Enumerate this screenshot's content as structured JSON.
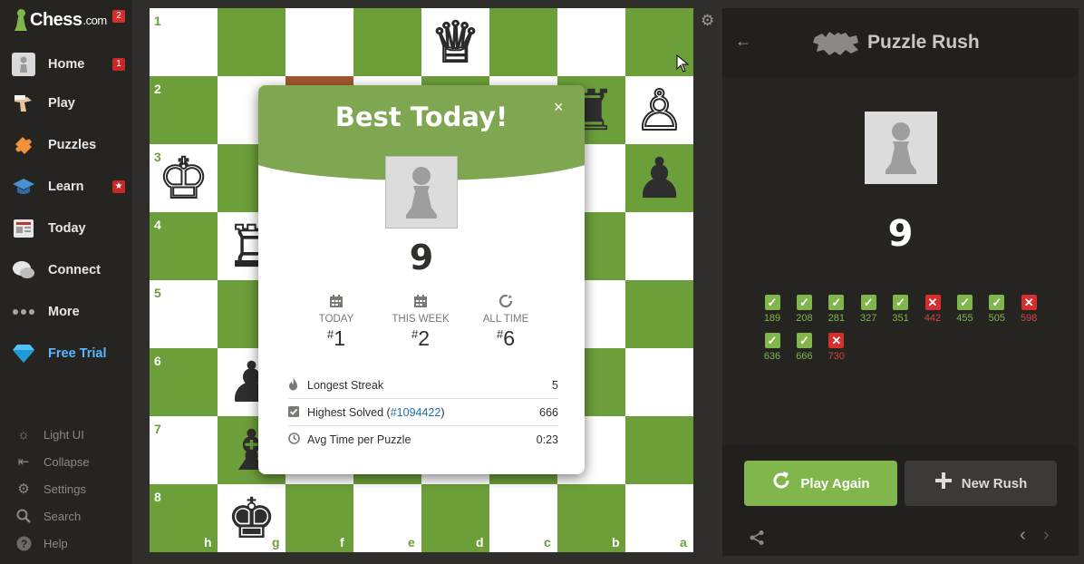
{
  "sidebar": {
    "logo": {
      "text": "Chess",
      "suffix": ".com",
      "badge": "2"
    },
    "items": [
      {
        "label": "Home",
        "icon": "home-avatar-icon",
        "badge": "1"
      },
      {
        "label": "Play",
        "icon": "play-hand-icon"
      },
      {
        "label": "Puzzles",
        "icon": "puzzle-piece-icon"
      },
      {
        "label": "Learn",
        "icon": "graduation-cap-icon",
        "badge": "★"
      },
      {
        "label": "Today",
        "icon": "newspaper-icon"
      },
      {
        "label": "Connect",
        "icon": "chat-bubbles-icon"
      },
      {
        "label": "More",
        "icon": "more-dots-icon"
      },
      {
        "label": "Free Trial",
        "icon": "diamond-icon"
      }
    ],
    "utilities": [
      {
        "label": "Light UI",
        "icon": "sun-icon"
      },
      {
        "label": "Collapse",
        "icon": "collapse-icon"
      },
      {
        "label": "Settings",
        "icon": "gear-icon"
      },
      {
        "label": "Search",
        "icon": "search-icon"
      },
      {
        "label": "Help",
        "icon": "help-icon"
      }
    ]
  },
  "board": {
    "ranks": [
      "1",
      "2",
      "3",
      "4",
      "5",
      "6",
      "7",
      "8"
    ],
    "files": [
      "h",
      "g",
      "f",
      "e",
      "d",
      "c",
      "b",
      "a"
    ],
    "light_color": "#ffffff",
    "dark_color": "#6c9e3a"
  },
  "modal": {
    "title": "Best Today!",
    "close": "×",
    "score": "9",
    "ranks": [
      {
        "title": "TODAY",
        "hash": "#",
        "value": "1"
      },
      {
        "title": "THIS WEEK",
        "hash": "#",
        "value": "2"
      },
      {
        "title": "ALL TIME",
        "hash": "#",
        "value": "6"
      }
    ],
    "stats": {
      "streak_label": "Longest Streak",
      "streak_value": "5",
      "highest_label_prefix": "Highest Solved (",
      "highest_link": "#1094422",
      "highest_label_suffix": ")",
      "highest_value": "666",
      "avg_label": "Avg Time per Puzzle",
      "avg_value": "0:23"
    }
  },
  "panel": {
    "title": "Puzzle Rush",
    "score": "9",
    "results": [
      {
        "rating": "189",
        "correct": true
      },
      {
        "rating": "208",
        "correct": true
      },
      {
        "rating": "281",
        "correct": true
      },
      {
        "rating": "327",
        "correct": true
      },
      {
        "rating": "351",
        "correct": true
      },
      {
        "rating": "442",
        "correct": false
      },
      {
        "rating": "455",
        "correct": true
      },
      {
        "rating": "505",
        "correct": true
      },
      {
        "rating": "598",
        "correct": false
      },
      {
        "rating": "636",
        "correct": true
      },
      {
        "rating": "666",
        "correct": true
      },
      {
        "rating": "730",
        "correct": false
      }
    ],
    "play_again": "Play Again",
    "new_rush": "New Rush"
  }
}
